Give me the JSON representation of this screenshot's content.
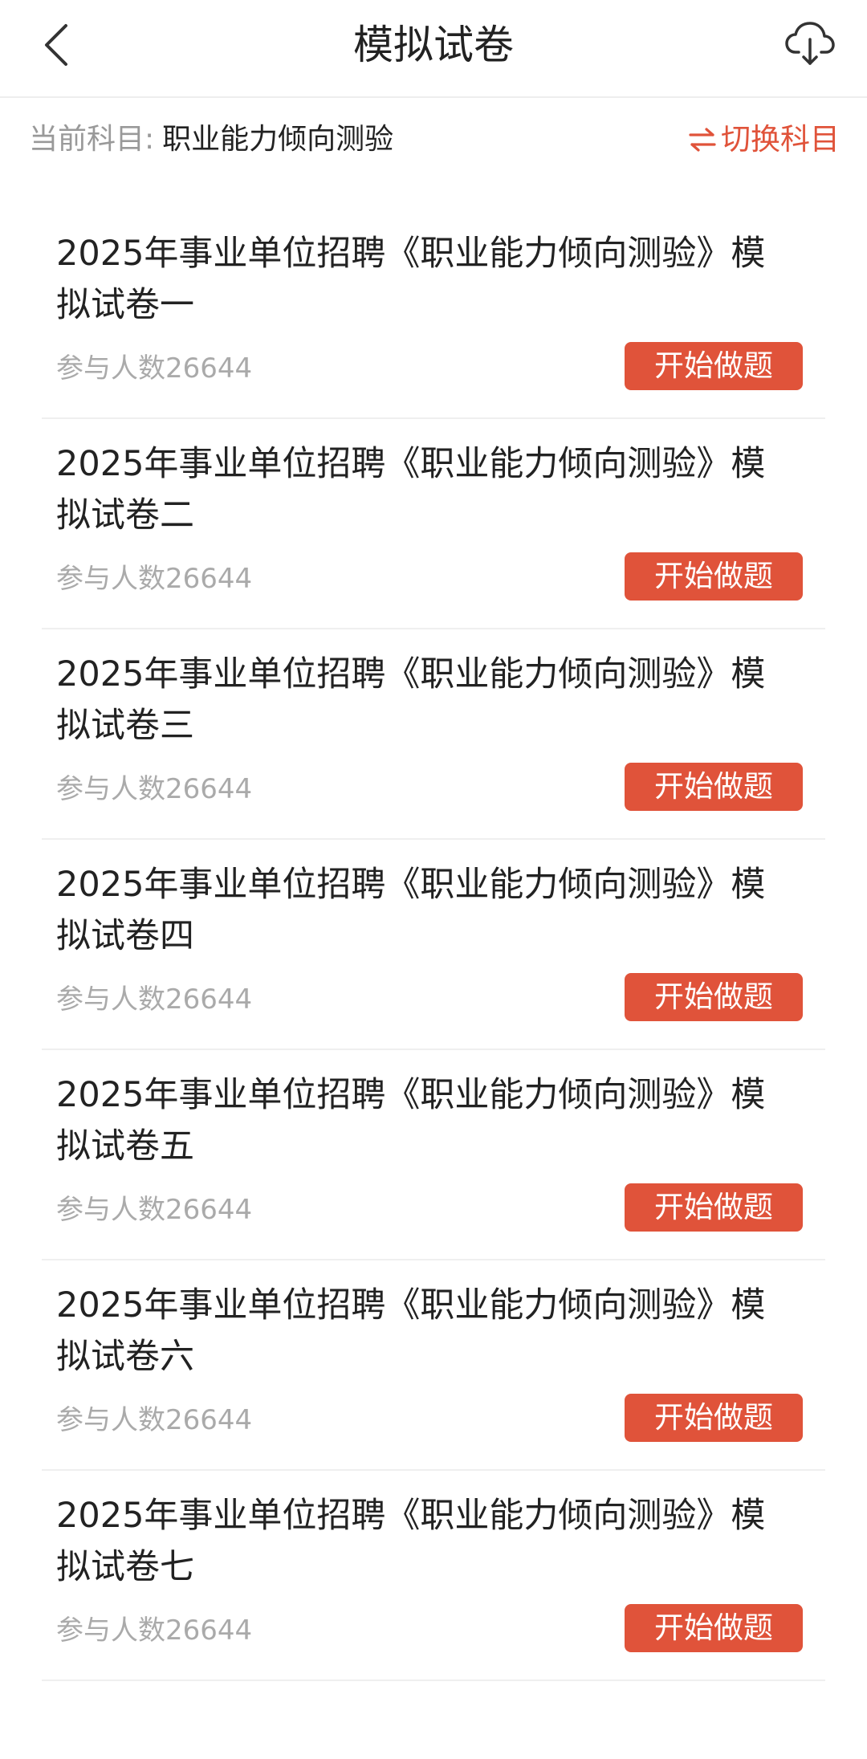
{
  "header": {
    "title": "模拟试卷",
    "back_icon": "chevron-left-icon",
    "download_icon": "cloud-download-icon"
  },
  "subject_bar": {
    "prefix": "当前科目:",
    "name": "职业能力倾向测验",
    "switch_label": "切换科目",
    "switch_icon": "swap-arrows-icon"
  },
  "colors": {
    "accent": "#e0533a",
    "muted_text": "#aaaaaa",
    "divider": "#efefef"
  },
  "papers": [
    {
      "title": "2025年事业单位招聘《职业能力倾向测验》模拟试卷一",
      "participants": "参与人数26644",
      "button": "开始做题"
    },
    {
      "title": "2025年事业单位招聘《职业能力倾向测验》模拟试卷二",
      "participants": "参与人数26644",
      "button": "开始做题"
    },
    {
      "title": "2025年事业单位招聘《职业能力倾向测验》模拟试卷三",
      "participants": "参与人数26644",
      "button": "开始做题"
    },
    {
      "title": "2025年事业单位招聘《职业能力倾向测验》模拟试卷四",
      "participants": "参与人数26644",
      "button": "开始做题"
    },
    {
      "title": "2025年事业单位招聘《职业能力倾向测验》模拟试卷五",
      "participants": "参与人数26644",
      "button": "开始做题"
    },
    {
      "title": "2025年事业单位招聘《职业能力倾向测验》模拟试卷六",
      "participants": "参与人数26644",
      "button": "开始做题"
    },
    {
      "title": "2025年事业单位招聘《职业能力倾向测验》模拟试卷七",
      "participants": "参与人数26644",
      "button": "开始做题"
    }
  ]
}
